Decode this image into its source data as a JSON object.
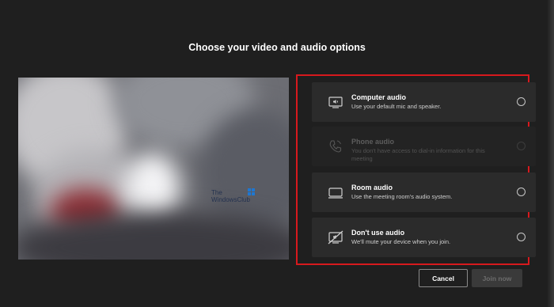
{
  "heading": "Choose your video and audio options",
  "preview": {
    "watermark_line1": "The",
    "watermark_line2": "WindowsClub"
  },
  "options": [
    {
      "title": "Computer audio",
      "description": "Use your default mic and speaker.",
      "icon": "computer-audio-icon",
      "enabled": true
    },
    {
      "title": "Phone audio",
      "description": "You don't have access to dial-in information for this meeting",
      "icon": "phone-icon",
      "enabled": false
    },
    {
      "title": "Room audio",
      "description": "Use the meeting room's audio system.",
      "icon": "room-audio-icon",
      "enabled": true
    },
    {
      "title": "Don't use audio",
      "description": "We'll mute your device when you join.",
      "icon": "no-audio-icon",
      "enabled": true
    }
  ],
  "buttons": {
    "cancel": "Cancel",
    "join": "Join now"
  },
  "colors": {
    "background": "#1f1f1f",
    "option_background": "#2b2b2b",
    "highlight_border": "#d7191d"
  }
}
